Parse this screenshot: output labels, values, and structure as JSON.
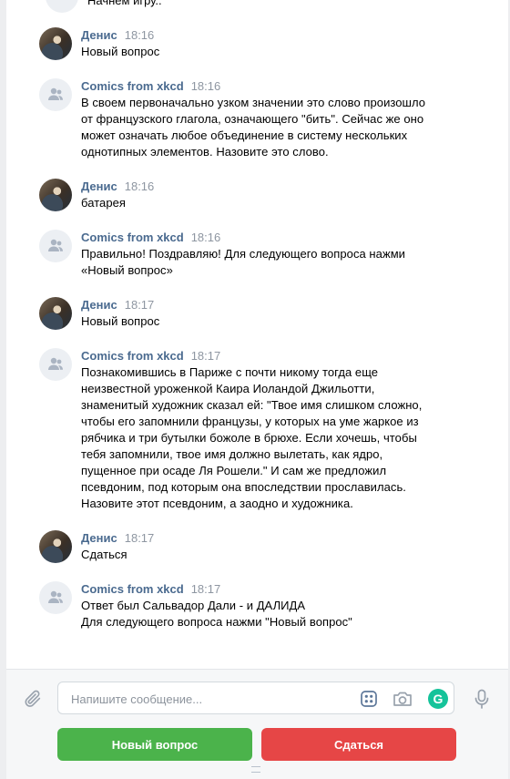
{
  "top_partial": {
    "text": "Начнем игру.."
  },
  "messages": [
    {
      "author": "Денис",
      "time": "18:16",
      "avatar": "user-photo",
      "text": "Новый вопрос"
    },
    {
      "author": "Comics from xkcd",
      "time": "18:16",
      "avatar": "group-icon",
      "text": "В своем первоначально узком значении это слово произошло\nот французского глагола, означающего \"бить\". Сейчас же оно\nможет означать любое объединение в систему нескольких\nоднотипных элементов. Назовите это слово."
    },
    {
      "author": "Денис",
      "time": "18:16",
      "avatar": "user-photo",
      "text": "батарея"
    },
    {
      "author": "Comics from xkcd",
      "time": "18:16",
      "avatar": "group-icon",
      "text": "Правильно! Поздравляю! Для следующего вопроса нажми\n«Новый вопрос»"
    },
    {
      "author": "Денис",
      "time": "18:17",
      "avatar": "user-photo",
      "text": "Новый вопрос"
    },
    {
      "author": "Comics from xkcd",
      "time": "18:17",
      "avatar": "group-icon",
      "text": "Познакомившись в Париже с почти никому тогда еще\nнеизвестной уроженкой Каира Иоландой Джильотти,\nзнаменитый художник сказал ей: \"Твое имя слишком сложно,\nчтобы его запомнили французы, у которых на уме жаркое из\nрябчика и три бутылки божоле в брюхе. Если хочешь, чтобы\nтебя запомнили, твое имя должно вылетать, как ядро,\nпущенное при осаде Ля Рошели.\" И сам же предложил\nпсевдоним, под которым она впоследствии прославилась.\nНазовите этот псевдоним, а заодно и художника."
    },
    {
      "author": "Денис",
      "time": "18:17",
      "avatar": "user-photo",
      "text": "Сдаться"
    },
    {
      "author": "Comics from xkcd",
      "time": "18:17",
      "avatar": "group-icon",
      "text": "Ответ был Сальвадор Дали - и ДАЛИДА\nДля следующего вопроса нажми \"Новый вопрос\""
    }
  ],
  "composer": {
    "placeholder": "Напишите сообщение...",
    "value": ""
  },
  "keyboard_buttons": {
    "new_question": "Новый вопрос",
    "give_up": "Сдаться"
  },
  "colors": {
    "author": "#4a6a8f",
    "time": "#8e96a1",
    "button_green": "#4bb34b",
    "button_red": "#e64646"
  }
}
